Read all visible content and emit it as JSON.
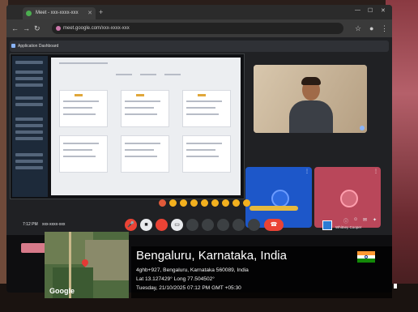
{
  "browser": {
    "tab_title": "Meet - xxx-xxxx-xxx",
    "url": "meet.google.com/xxx-xxxx-xxx"
  },
  "meet": {
    "header_title": "Application Dashboard",
    "meeting_time": "7:12 PM",
    "meeting_code": "xxx-xxxx-xxx",
    "participant_label": "Whitney Cooper"
  },
  "geotag": {
    "map_logo": "Google",
    "title": "Bengaluru, Karnataka, India",
    "address": "4ghb+927, Bengaluru, Karnataka 560089, India",
    "coords": "Lat 13.127429° Long 77.504502°",
    "datetime": "Tuesday, 21/10/2025 07:12 PM GMT +05:30"
  },
  "colors": {
    "meet_bg": "#202124",
    "end_call": "#ea4335",
    "tile_blue": "#1d57c9",
    "tile_pink": "#b9475a",
    "flag_saffron": "#ff9933",
    "flag_green": "#138808"
  }
}
